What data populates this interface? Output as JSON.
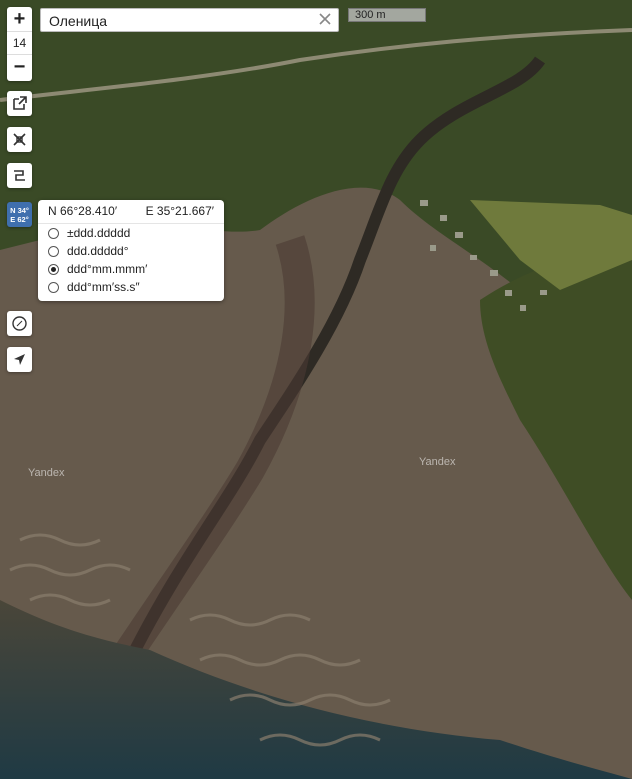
{
  "search": {
    "value": "Оленица",
    "placeholder": ""
  },
  "zoom": {
    "plus": "+",
    "level": "14",
    "minus": "−"
  },
  "scale_label": "300 m",
  "coord_button": {
    "line1": "N 34°",
    "line2": "E 62°"
  },
  "coordinates": {
    "lat": "N 66°28.410′",
    "lon": "E 35°21.667′",
    "formats": [
      {
        "label": "±ddd.ddddd",
        "selected": false
      },
      {
        "label": "ddd.ddddd°",
        "selected": false
      },
      {
        "label": "ddd°mm.mmm′",
        "selected": true
      },
      {
        "label": "ddd°mm′ss.s″",
        "selected": false
      }
    ]
  },
  "watermarks": [
    "Yandex",
    "Yandex"
  ],
  "icons": [
    "external-link-icon",
    "satellite-icon",
    "map-layers-icon",
    "compass-icon",
    "locate-icon",
    "close-icon"
  ]
}
